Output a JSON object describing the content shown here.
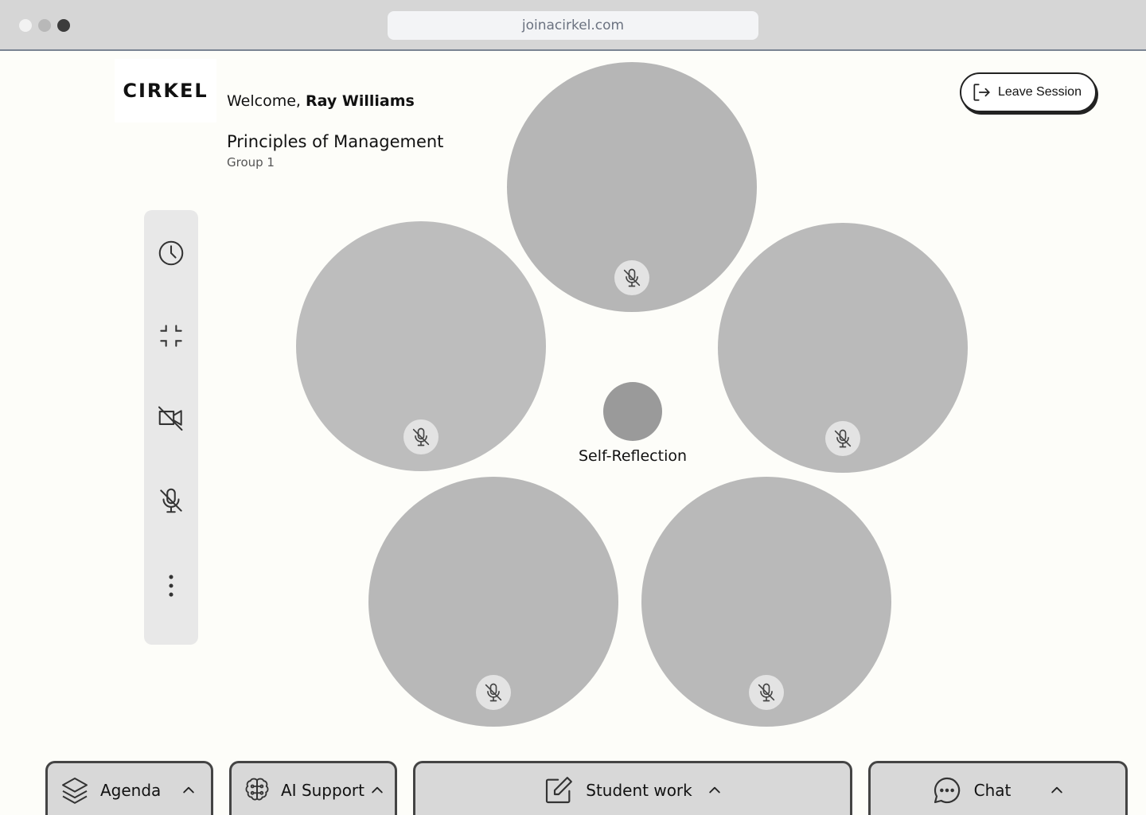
{
  "browser": {
    "url": "joinacirkel.com"
  },
  "brand": {
    "logo_text": "CIRKEL"
  },
  "header": {
    "welcome_prefix": "Welcome, ",
    "user_name": "Ray Williams",
    "course_title": "Principles of Management",
    "group_label": "Group 1",
    "leave_label": "Leave Session"
  },
  "toolbar": {
    "items": [
      {
        "icon": "clock-icon"
      },
      {
        "icon": "minimize-icon"
      },
      {
        "icon": "video-off-icon"
      },
      {
        "icon": "mic-off-icon"
      },
      {
        "icon": "more-vertical-icon"
      }
    ]
  },
  "participants": [
    {
      "muted": true,
      "color": "#b6b6b6"
    },
    {
      "muted": true,
      "color": "#bdbdbd"
    },
    {
      "muted": true,
      "color": "#bababa"
    },
    {
      "muted": true,
      "color": "#b8b8b8"
    },
    {
      "muted": true,
      "color": "#b9b9b9"
    }
  ],
  "center": {
    "label": "Self-Reflection"
  },
  "bottom_tabs": [
    {
      "label": "Agenda"
    },
    {
      "label": "AI Support"
    },
    {
      "label": "Student work"
    },
    {
      "label": "Chat"
    }
  ],
  "colors": {
    "background": "#fdfdf9",
    "toolbar_bg": "#e8e8e8",
    "tab_bg": "#d8d8d8",
    "center_dot": "#9a9a9a"
  }
}
